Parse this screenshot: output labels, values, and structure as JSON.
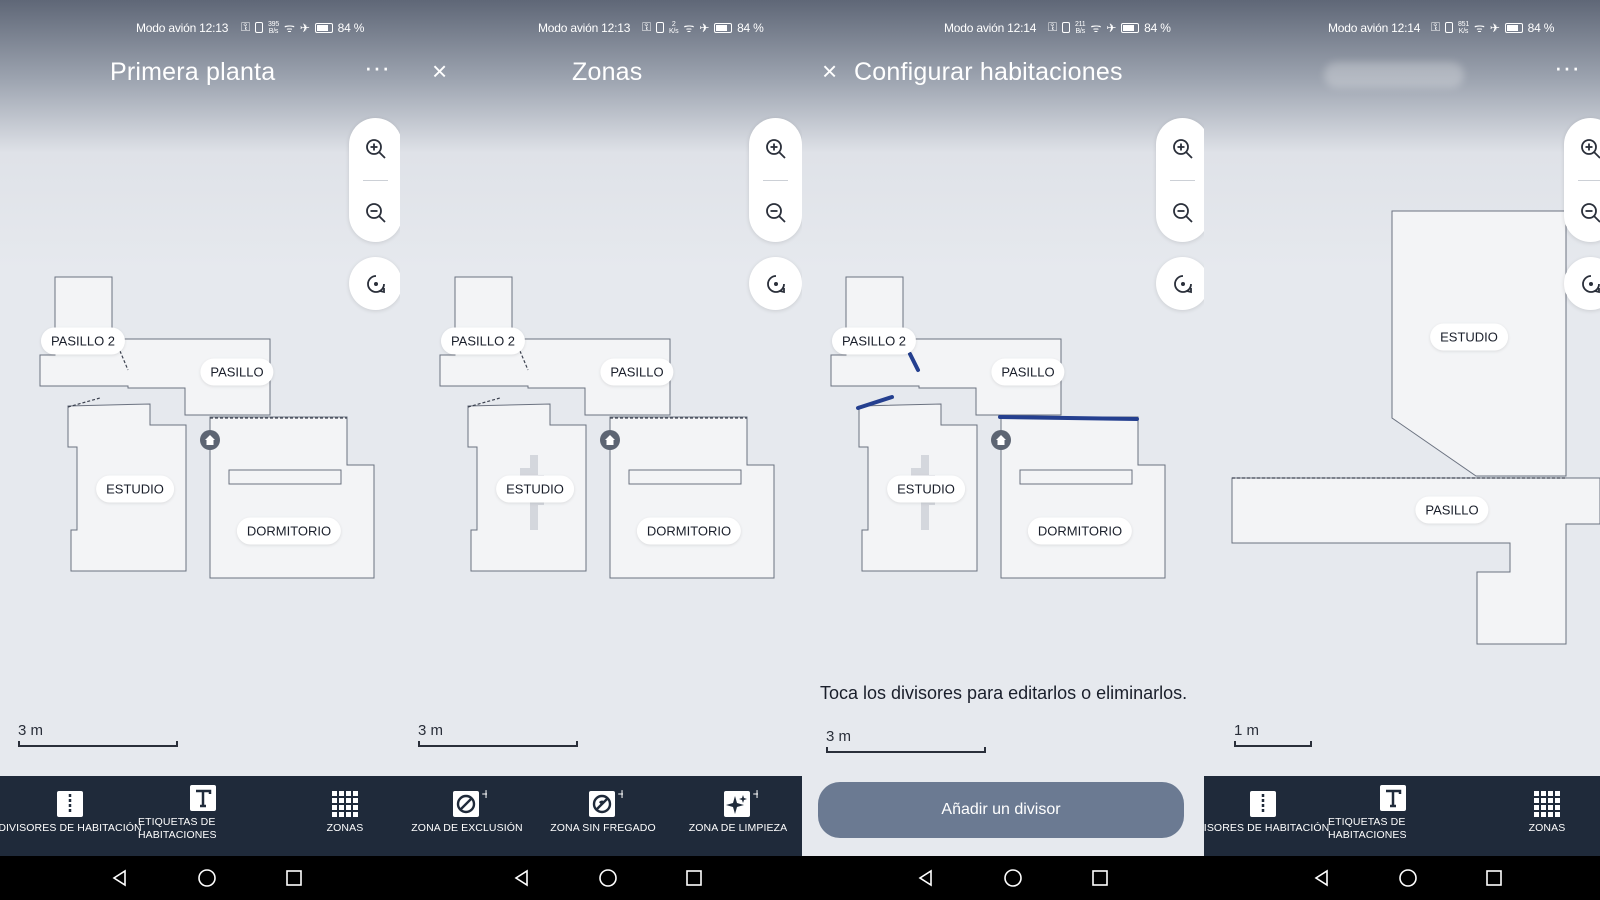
{
  "status": {
    "p1": {
      "text": "Modo avión 12:13",
      "netspeed_top": "395",
      "netspeed_bottom": "B/s",
      "battery": "84 %"
    },
    "p2": {
      "text": "Modo avión 12:13",
      "netspeed_top": "2",
      "netspeed_bottom": "K/s",
      "battery": "84 %"
    },
    "p3": {
      "text": "Modo avión 12:14",
      "netspeed_top": "211",
      "netspeed_bottom": "B/s",
      "battery": "84 %"
    },
    "p4": {
      "text": "Modo avión 12:14",
      "netspeed_top": "851",
      "netspeed_bottom": "K/s",
      "battery": "84 %"
    }
  },
  "panels": {
    "p1": {
      "title": "Primera planta",
      "menu": "···",
      "scale": "3 m"
    },
    "p2": {
      "title": "Zonas",
      "close": "×",
      "scale": "3 m"
    },
    "p3": {
      "title": "Configurar habitaciones",
      "close": "×",
      "scale": "3 m",
      "hint": "Toca los divisores para editarlos o eliminarlos.",
      "add_button": "Añadir un divisor"
    },
    "p4": {
      "menu": "···",
      "scale": "1 m"
    }
  },
  "rooms": {
    "pasillo2": "PASILLO 2",
    "pasillo": "PASILLO",
    "estudio": "ESTUDIO",
    "dormitorio": "DORMITORIO"
  },
  "toolbar_main": {
    "dividers": "DIVISORES DE HABITACIÓN",
    "dividers_cut": "VISORES DE HABITACIÓN",
    "labels_line1": "ETIQUETAS DE",
    "labels_line2": "HABITACIONES",
    "zones": "ZONAS"
  },
  "toolbar_zones": {
    "exclusion": "ZONA DE EXCLUSIÓN",
    "no_mop": "ZONA SIN FREGADO",
    "cleaning": "ZONA DE LIMPIEZA"
  },
  "colors": {
    "toolbar_bg": "#1f2a3a",
    "divider_blue": "#243f8f",
    "add_button": "#6b7a92",
    "room_fill": "#f3f4f6",
    "room_stroke": "#6b7280"
  },
  "icons": [
    "zoom-in-icon",
    "zoom-out-icon",
    "recenter-icon",
    "dock-home-icon",
    "back-icon",
    "home-circle-icon",
    "recents-square-icon"
  ]
}
